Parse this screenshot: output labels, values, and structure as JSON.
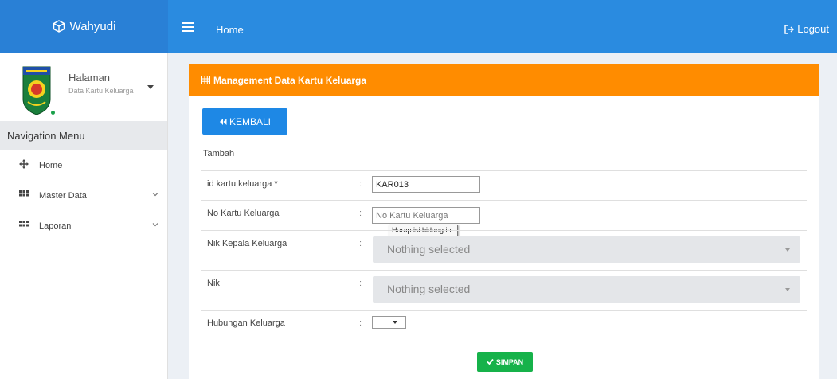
{
  "brand": {
    "name": "Wahyudi",
    "icon": "cube-icon"
  },
  "header": {
    "title": "Home",
    "logout_label": "Logout",
    "menu_icon": "hamburger-icon",
    "logout_icon": "sign-out-icon"
  },
  "user_panel": {
    "title": "Halaman",
    "subtitle": "Data Kartu Keluarga",
    "status": "online"
  },
  "sidebar": {
    "header": "Navigation Menu",
    "items": [
      {
        "label": "Home",
        "icon": "arrows-move-icon",
        "has_submenu": false
      },
      {
        "label": "Master Data",
        "icon": "grid-icon",
        "has_submenu": true
      },
      {
        "label": "Laporan",
        "icon": "grid-icon",
        "has_submenu": true
      }
    ]
  },
  "panel": {
    "title": "Management Data Kartu Keluarga",
    "back_label": "KEMBALI",
    "section": "Tambah",
    "fields": {
      "id_kartu": {
        "label": "id kartu keluarga *",
        "value": "KAR013"
      },
      "no_kartu": {
        "label": "No Kartu Keluarga",
        "placeholder": "No Kartu Keluarga"
      },
      "nik_kepala": {
        "label": "Nik Kepala Keluarga",
        "value": "Nothing selected"
      },
      "nik": {
        "label": "Nik",
        "value": "Nothing selected"
      },
      "hubungan": {
        "label": "Hubungan Keluarga",
        "value": ""
      }
    },
    "colon": ":",
    "tooltip": "Harap isi bidang ini.",
    "save_label": "SIMPAN"
  },
  "colors": {
    "topbar": "#2a8be0",
    "brand_bg": "#2980d6",
    "panel_header": "#ff8c00",
    "back_button": "#1e88e5",
    "save_button": "#16b24a"
  }
}
